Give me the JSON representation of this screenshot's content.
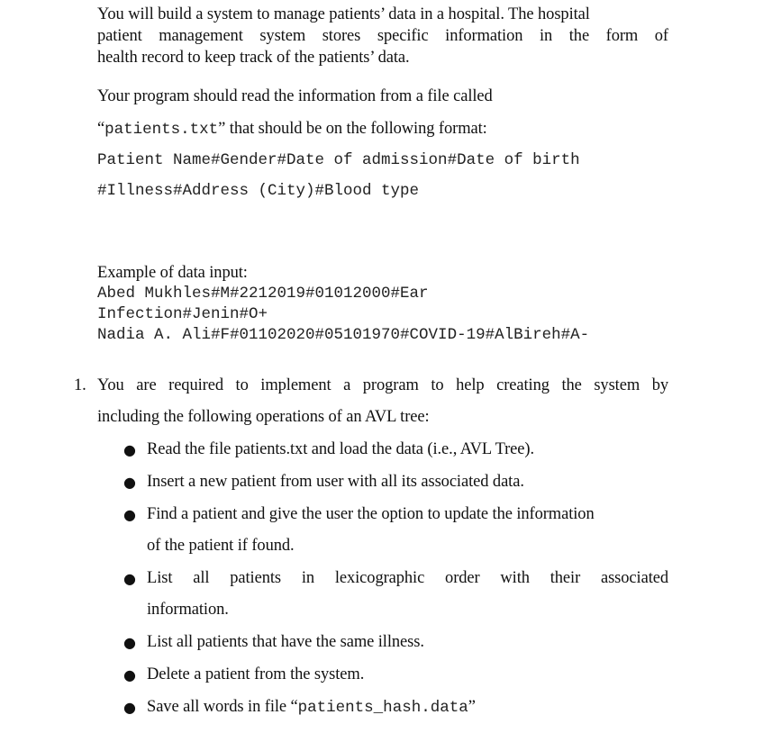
{
  "intro": {
    "line1": "You will build a system to manage patients’ data in a hospital. The hospital",
    "line2": "patient management system stores specific information in the form of",
    "line3": "health record to keep track of the patients’ data."
  },
  "format": {
    "read_line": "Your program should read the information from a file called",
    "file_open_quote": "“",
    "file_name": "patients.txt",
    "file_rest": "” that should be on the following format:",
    "format_line1": "Patient Name#Gender#Date of admission#Date of birth",
    "format_line2": "#Illness#Address (City)#Blood type"
  },
  "example": {
    "heading": "Example of data input:",
    "lines": [
      "Abed Mukhles#M#2212019#01012000#Ear",
      "Infection#Jenin#O+",
      "Nadia A. Ali#F#01102020#05101970#COVID-19#AlBireh#A-"
    ]
  },
  "task": {
    "number": "1.",
    "line1": "You are required to implement a program to help creating the system by",
    "line2": "including the following operations of an AVL tree:",
    "bullet_symbol": "●",
    "bullets": [
      "Read the file patients.txt and load the data (i.e., AVL Tree).",
      "Insert a new patient from user with all its associated data.",
      "Find a patient and give the user the option to update the information",
      "of the patient if found.",
      "List all patients in lexicographic order with their associated",
      "information.",
      "List all patients that have the same illness.",
      "Delete a patient from the system.",
      "Save all words in file "
    ],
    "save_file_open_quote": "“",
    "save_file_name": "patients_hash.data",
    "save_file_close_quote": "”"
  }
}
